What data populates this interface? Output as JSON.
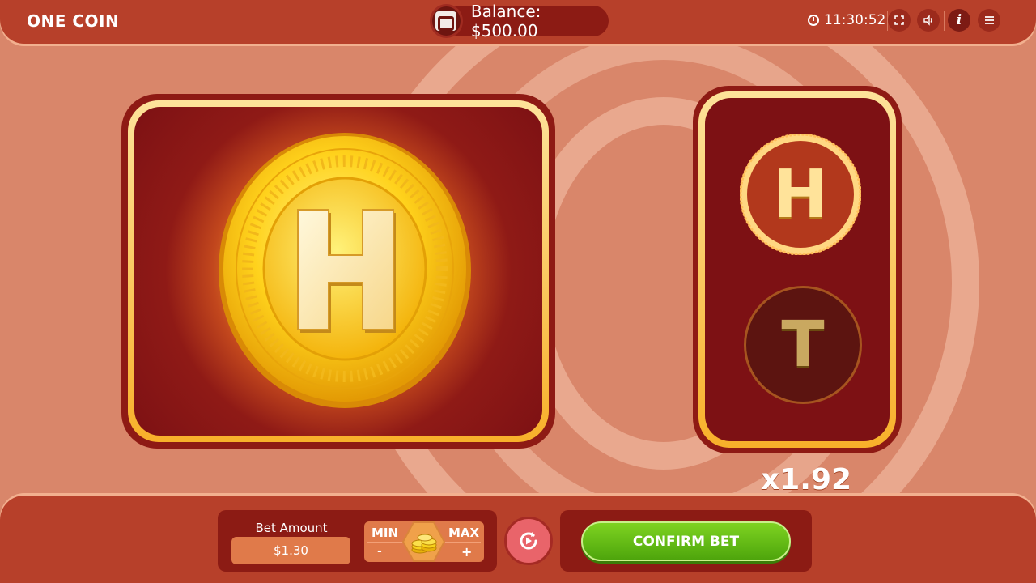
{
  "header": {
    "title": "ONE COIN",
    "balance_text": "Balance: $500.00",
    "clock": "11:30:52",
    "icons": [
      "wallet-icon",
      "clock-icon",
      "fullscreen-icon",
      "sound-icon",
      "info-icon",
      "menu-icon"
    ]
  },
  "game": {
    "current_coin_face": "H",
    "choices": [
      {
        "label": "H",
        "selected": true
      },
      {
        "label": "T",
        "selected": false
      }
    ],
    "multiplier": "x1.92"
  },
  "bet": {
    "label": "Bet Amount",
    "amount": "$1.30",
    "min_label": "MIN",
    "max_label": "MAX",
    "minus_label": "-",
    "plus_label": "+"
  },
  "actions": {
    "confirm_label": "CONFIRM BET"
  },
  "colors": {
    "topbar": "#b7402a",
    "background": "#d9866a",
    "panel": "#7d1114",
    "gold": "#f8b02a",
    "confirm_green": "#5fb913",
    "refresh": "#e9646a"
  }
}
